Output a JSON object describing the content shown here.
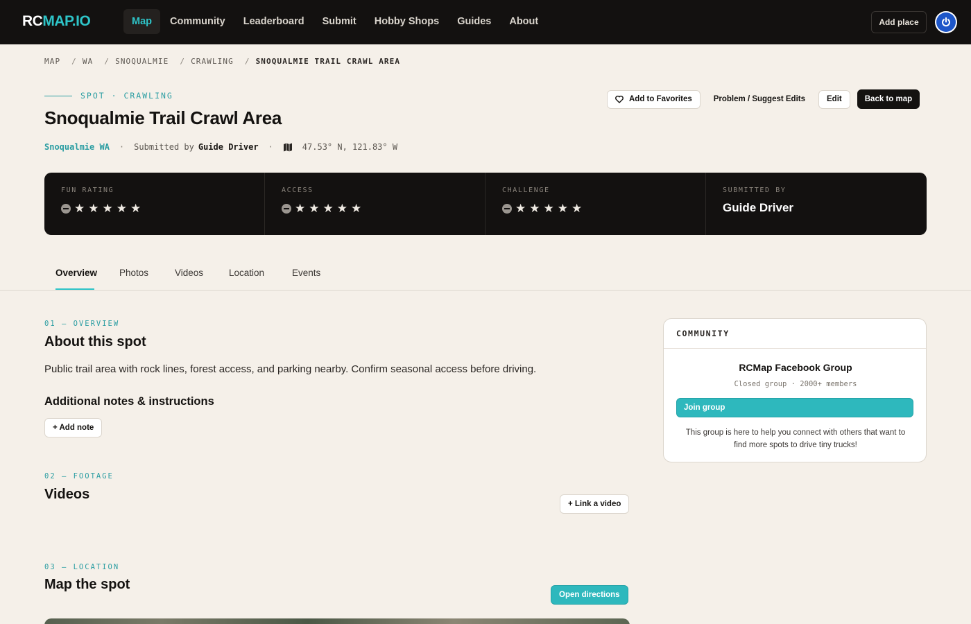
{
  "brand": {
    "logo_part1": "RC",
    "logo_part2": "MAP.IO"
  },
  "nav": {
    "items": [
      {
        "label": "Map",
        "active": true
      },
      {
        "label": "Community"
      },
      {
        "label": "Leaderboard"
      },
      {
        "label": "Submit"
      },
      {
        "label": "Hobby Shops"
      },
      {
        "label": "Guides"
      },
      {
        "label": "About"
      }
    ],
    "add_place": "Add place"
  },
  "breadcrumb": [
    "MAP",
    "WA",
    "SNOQUALMIE",
    "CRAWLING",
    "SNOQUALMIE TRAIL CRAWL AREA"
  ],
  "header": {
    "eyebrow": "SPOT · CRAWLING",
    "title": "Snoqualmie Trail Crawl Area",
    "location": "Snoqualmie WA",
    "submitted_prefix": "Submitted by",
    "submitted_by": "Guide Driver",
    "coords": "47.53° N, 121.83° W"
  },
  "actions": {
    "favorites": "Add to Favorites",
    "suggest": "Problem / Suggest Edits",
    "edit": "Edit",
    "back": "Back to map"
  },
  "stats": [
    {
      "label": "FUN RATING",
      "stars": 5,
      "filled": 0
    },
    {
      "label": "ACCESS",
      "stars": 5,
      "filled": 0
    },
    {
      "label": "CHALLENGE",
      "stars": 5,
      "filled": 0
    },
    {
      "label": "SUBMITTED BY",
      "value": "Guide Driver"
    }
  ],
  "tabs": [
    "Overview",
    "Photos",
    "Videos",
    "Location",
    "Events"
  ],
  "overview": {
    "eyebrow": "01 — OVERVIEW",
    "title": "About this spot",
    "text": "Public trail area with rock lines, forest access, and parking nearby. Confirm seasonal access before driving.",
    "notes_title": "Additional notes & instructions",
    "add_note": "+ Add note"
  },
  "footage": {
    "eyebrow": "02 — FOOTAGE",
    "title": "Videos",
    "link_video": "+ Link a video"
  },
  "location": {
    "eyebrow": "03 — LOCATION",
    "title": "Map the spot",
    "directions": "Open directions"
  },
  "community": {
    "heading": "COMMUNITY",
    "group_name": "RCMap Facebook Group",
    "group_meta": "Closed group · 2000+ members",
    "join": "Join group",
    "description": "This group is here to help you connect with others that want to find more spots to drive tiny trucks!"
  }
}
